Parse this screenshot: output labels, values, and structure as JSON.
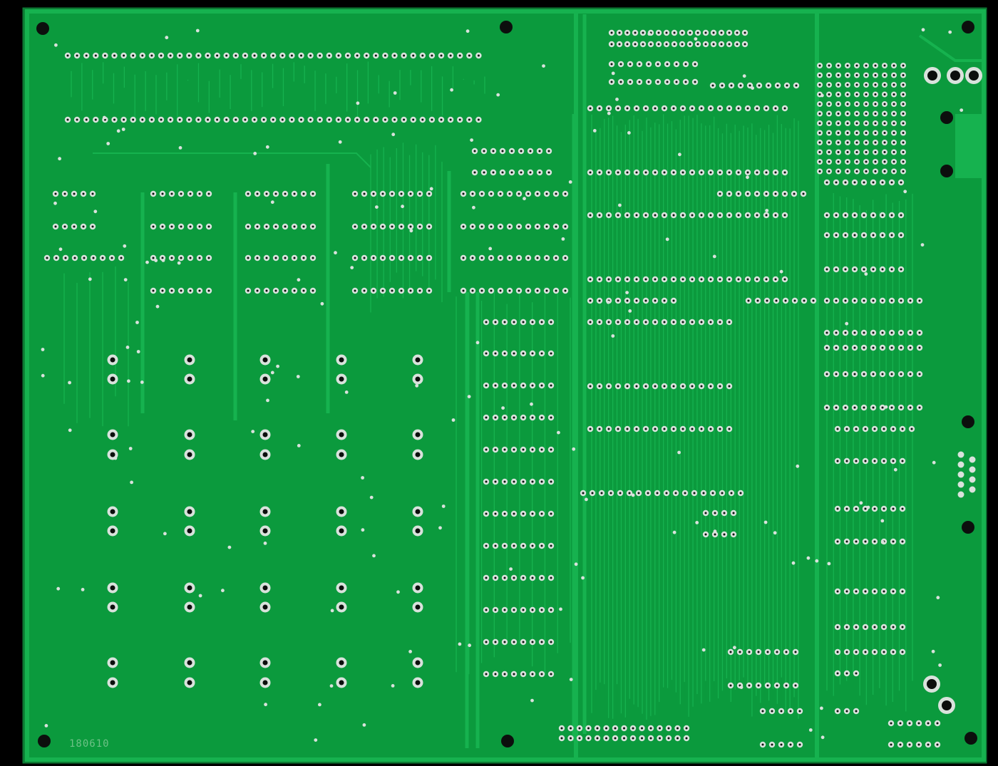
{
  "image": {
    "subject": "pcb",
    "colors": {
      "background": "#000000",
      "board": "#0b9a3d",
      "copper": "#16b24f",
      "pad": "#d9e2dc",
      "hole": "#0c0f0d",
      "silkscreen": "#7fc893"
    }
  },
  "board": {
    "silkscreen_label": "180610"
  }
}
